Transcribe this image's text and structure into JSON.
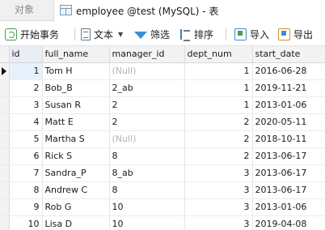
{
  "tabs": {
    "objects_label": "对象",
    "active_label": "employee @test (MySQL) - 表"
  },
  "toolbar": {
    "begin_transaction": "开始事务",
    "text": "文本",
    "filter": "筛选",
    "sort": "排序",
    "import": "导入",
    "export": "导出"
  },
  "grid": {
    "columns": [
      "id",
      "full_name",
      "manager_id",
      "dept_num",
      "start_date"
    ],
    "null_text": "(Null)",
    "rows": [
      {
        "id": "1",
        "full_name": "Tom H",
        "manager_id": "(Null)",
        "dept_num": "1",
        "start_date": "2016-06-28"
      },
      {
        "id": "2",
        "full_name": "Bob_B",
        "manager_id": "2_ab",
        "dept_num": "1",
        "start_date": "2019-11-21"
      },
      {
        "id": "3",
        "full_name": "Susan R",
        "manager_id": "2",
        "dept_num": "1",
        "start_date": "2013-01-06"
      },
      {
        "id": "4",
        "full_name": "Matt E",
        "manager_id": "2",
        "dept_num": "2",
        "start_date": "2020-05-11"
      },
      {
        "id": "5",
        "full_name": "Martha S",
        "manager_id": "(Null)",
        "dept_num": "2",
        "start_date": "2018-10-11"
      },
      {
        "id": "6",
        "full_name": "Rick S",
        "manager_id": "8",
        "dept_num": "2",
        "start_date": "2013-06-17"
      },
      {
        "id": "7",
        "full_name": "Sandra_P",
        "manager_id": "8_ab",
        "dept_num": "3",
        "start_date": "2013-06-17"
      },
      {
        "id": "8",
        "full_name": "Andrew C",
        "manager_id": "8",
        "dept_num": "3",
        "start_date": "2013-06-17"
      },
      {
        "id": "9",
        "full_name": "Rob G",
        "manager_id": "10",
        "dept_num": "3",
        "start_date": "2013-01-06"
      },
      {
        "id": "10",
        "full_name": "Lisa D",
        "manager_id": "10",
        "dept_num": "3",
        "start_date": "2019-04-08"
      }
    ]
  }
}
